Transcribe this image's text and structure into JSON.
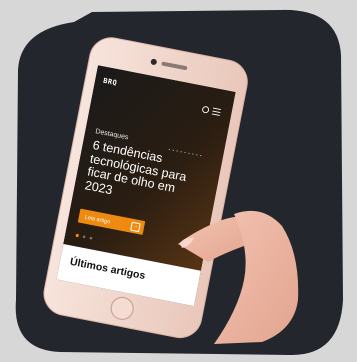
{
  "app": {
    "brand": "BRQ",
    "eyebrow": "Destaques",
    "headline_lines": [
      "6 tendências",
      "tecnológicas para",
      "ficar de olho em",
      "2023"
    ],
    "cta_label": "Leia artigo",
    "section_title": "Últimos artigos"
  },
  "carousel": {
    "total": 3,
    "active": 1
  },
  "colors": {
    "background": "#d7d7d7",
    "dark_blob": "#24262d",
    "phone_frame": "#f4d9cf",
    "screen": "#141414",
    "accent_orange": "#ef8a10",
    "skin": "#eeb7a3"
  },
  "icons": [
    "search-icon",
    "menu-icon",
    "arrow-right-icon"
  ]
}
